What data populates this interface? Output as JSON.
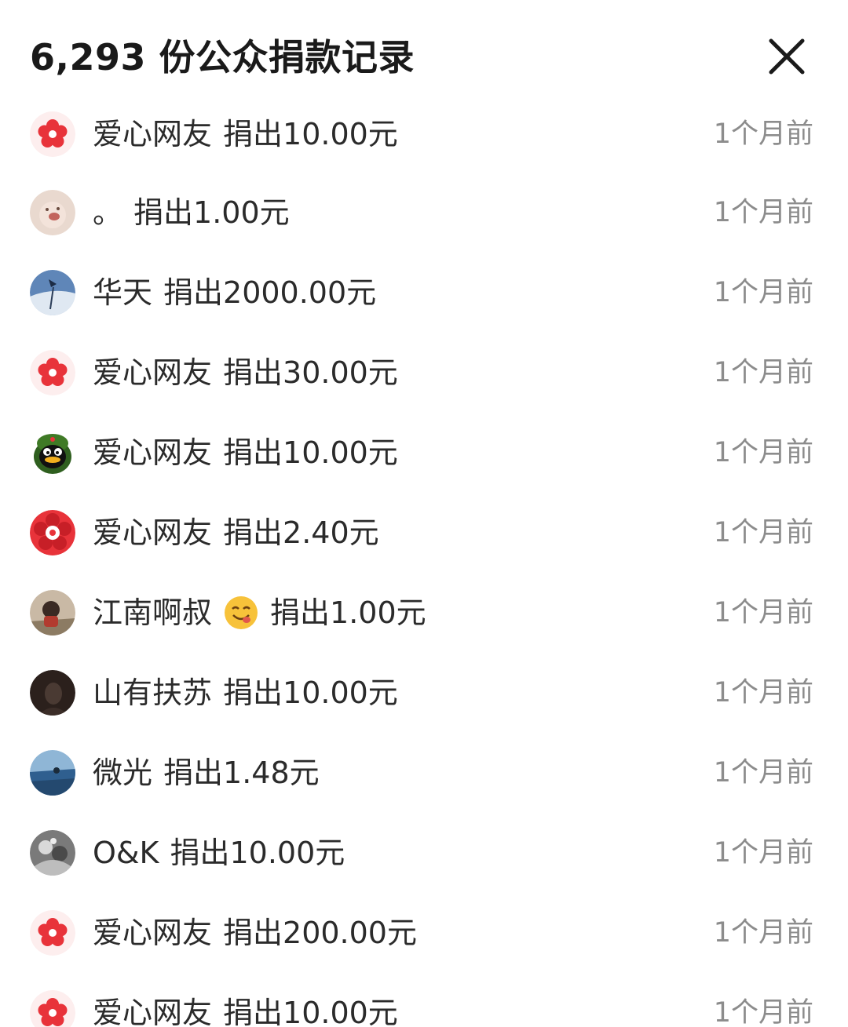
{
  "header": {
    "title": "6,293 份公众捐款记录",
    "close_icon": "close-icon"
  },
  "donations": [
    {
      "name": "爱心网友",
      "action": "捐出10.00元",
      "time": "1个月前",
      "avatar": "red-flower-avatar"
    },
    {
      "name": "。",
      "action": "捐出1.00元",
      "time": "1个月前",
      "avatar": "photo-avatar"
    },
    {
      "name": "华天",
      "action": "捐出2000.00元",
      "time": "1个月前",
      "avatar": "sky-photo-avatar"
    },
    {
      "name": "爱心网友",
      "action": "捐出30.00元",
      "time": "1个月前",
      "avatar": "red-flower-avatar"
    },
    {
      "name": "爱心网友",
      "action": "捐出10.00元",
      "time": "1个月前",
      "avatar": "penguin-avatar"
    },
    {
      "name": "爱心网友",
      "action": "捐出2.40元",
      "time": "1个月前",
      "avatar": "red-flower-avatar"
    },
    {
      "name": "江南啊叔",
      "action": "捐出1.00元",
      "time": "1个月前",
      "avatar": "photo-avatar",
      "emoji": "smiling-face-emoji"
    },
    {
      "name": "山有扶苏",
      "action": "捐出10.00元",
      "time": "1个月前",
      "avatar": "dark-photo-avatar"
    },
    {
      "name": "微光",
      "action": "捐出1.48元",
      "time": "1个月前",
      "avatar": "sea-photo-avatar"
    },
    {
      "name": "O&K",
      "action": "捐出10.00元",
      "time": "1个月前",
      "avatar": "grayscale-photo-avatar"
    },
    {
      "name": "爱心网友",
      "action": "捐出200.00元",
      "time": "1个月前",
      "avatar": "red-flower-avatar"
    },
    {
      "name": "爱心网友",
      "action": "捐出10.00元",
      "time": "1个月前",
      "avatar": "red-flower-avatar"
    }
  ],
  "colors": {
    "title": "#1a1a1a",
    "text": "#2b2b2b",
    "time": "#8c8c8c",
    "flower": "#e8333a"
  }
}
